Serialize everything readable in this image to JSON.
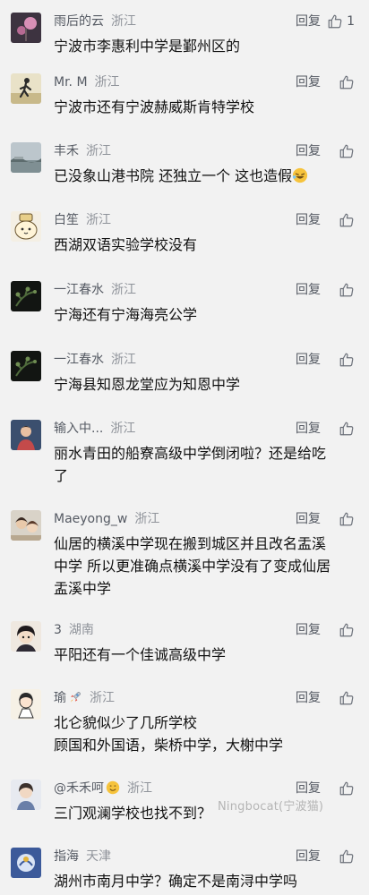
{
  "reply_label": "回复",
  "watermark": "Ningbocat(宁波猫)",
  "comments": [
    {
      "user": "雨后的云",
      "location": "浙江",
      "likes": "1",
      "lines": [
        "宁波市李惠利中学是鄞州区的"
      ]
    },
    {
      "user": "Mr. M",
      "location": "浙江",
      "likes": "",
      "lines": [
        "宁波市还有宁波赫威斯肯特学校"
      ]
    },
    {
      "user": "丰禾",
      "location": "浙江",
      "likes": "",
      "lines": [
        "已没象山港书院   还独立一个   这也造假"
      ]
    },
    {
      "user": "白笙",
      "location": "浙江",
      "likes": "",
      "lines": [
        "西湖双语实验学校没有"
      ]
    },
    {
      "user": "一江春水",
      "location": "浙江",
      "likes": "",
      "lines": [
        "宁海还有宁海海亮公学"
      ]
    },
    {
      "user": "一江春水",
      "location": "浙江",
      "likes": "",
      "lines": [
        "宁海县知恩龙堂应为知恩中学"
      ]
    },
    {
      "user": "输入中...",
      "location": "浙江",
      "likes": "",
      "lines": [
        "丽水青田的船寮高级中学倒闭啦？还是给吃",
        "了"
      ]
    },
    {
      "user": "Maeyong_w",
      "location": "浙江",
      "likes": "",
      "lines": [
        "仙居的横溪中学现在搬到城区并且改名盂溪",
        "中学 所以更准确点横溪中学没有了变成仙居",
        "盂溪中学"
      ]
    },
    {
      "user": "3",
      "location": "湖南",
      "likes": "",
      "lines": [
        "平阳还有一个佳诚高级中学"
      ]
    },
    {
      "user": "瑜",
      "location": "浙江",
      "likes": "",
      "lines": [
        "北仑貌似少了几所学校",
        "顾国和外国语，柴桥中学，大榭中学"
      ]
    },
    {
      "user": "@禾禾呵",
      "location": "浙江",
      "likes": "",
      "lines": [
        "三门观澜学校也找不到？"
      ]
    },
    {
      "user": "指海",
      "location": "天津",
      "likes": "",
      "lines": [
        "湖州市南月中学？确定不是南浔中学吗"
      ]
    }
  ]
}
